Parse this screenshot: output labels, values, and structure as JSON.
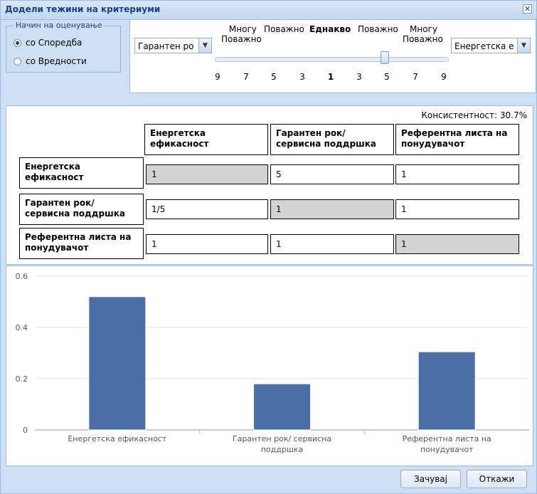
{
  "window": {
    "title": "Додели тежини на критериуми",
    "close_glyph": "✕"
  },
  "method": {
    "legend": "Начин на оценување",
    "options": [
      {
        "label": "со Споредба",
        "selected": true
      },
      {
        "label": "со Вредности",
        "selected": false
      }
    ]
  },
  "slider": {
    "left_criterion": "Гарантен ро",
    "right_criterion": "Енергетска е",
    "labels": {
      "very_left_1": "Многу",
      "very_left_2": "Поважно",
      "more_left": "Поважно",
      "equal": "Еднакво",
      "more_right": "Поважно",
      "very_right_1": "Многу",
      "very_right_2": "Поважно"
    },
    "ticks": [
      "9",
      "7",
      "5",
      "3",
      "1",
      "3",
      "5",
      "7",
      "9"
    ],
    "selected_index": 6
  },
  "matrix": {
    "consistency_label": "Консистентност: 30.7%",
    "columns": [
      "Енергетска ефикасност",
      "Гарантен рок/ сервисна поддршка",
      "Референтна листа на понудувачот"
    ],
    "rows": [
      {
        "label": "Енергетска ефикасност",
        "values": [
          "1",
          "5",
          "1"
        ]
      },
      {
        "label": "Гарантен рок/ сервисна поддршка",
        "values": [
          "1/5",
          "1",
          "1"
        ]
      },
      {
        "label": "Референтна листа на понудувачот",
        "values": [
          "1",
          "1",
          "1"
        ]
      }
    ]
  },
  "chart_data": {
    "type": "bar",
    "categories": [
      "Енергетска ефикасност",
      "Гарантен рок/ сервисна поддршка",
      "Референтна листа на понудувачот"
    ],
    "values": [
      0.52,
      0.18,
      0.305
    ],
    "ylim": [
      0,
      0.6
    ],
    "yticks": [
      "0",
      "0.2",
      "0.4",
      "0.6"
    ],
    "grid": true,
    "bar_color": "#4a6fa5"
  },
  "footer": {
    "save_label": "Зачувај",
    "cancel_label": "Откажи"
  }
}
